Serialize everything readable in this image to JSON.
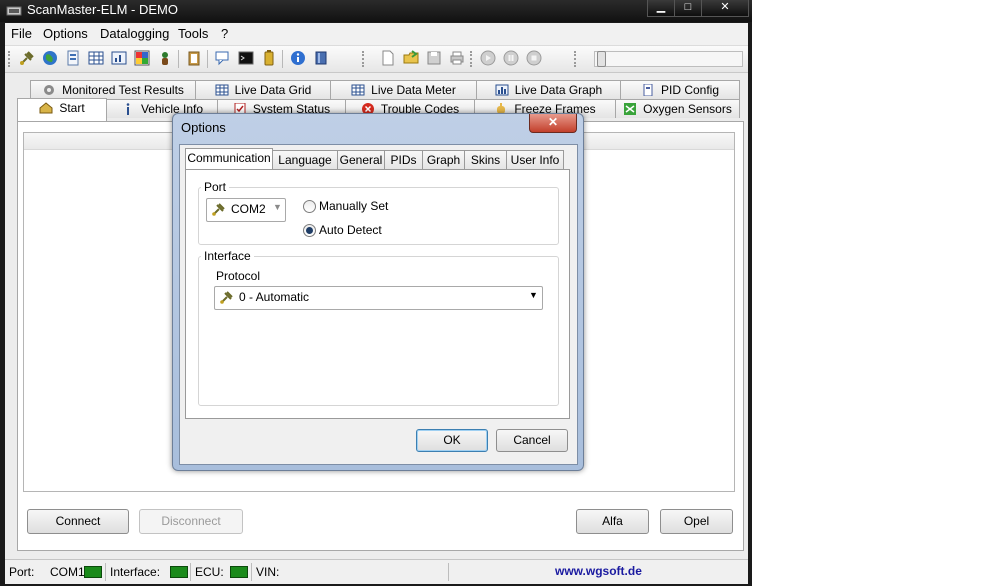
{
  "window": {
    "title": "ScanMaster-ELM - DEMO",
    "controls": {
      "minimize": "▁",
      "maximize": "□",
      "close": "✕"
    }
  },
  "menu": [
    "File",
    "Options",
    "Datalogging",
    "Tools",
    "?"
  ],
  "tabs": {
    "row1": [
      "Monitored Test Results",
      "Live Data Grid",
      "Live Data Meter",
      "Live Data Graph",
      "PID Config"
    ],
    "row2": [
      "Start",
      "Vehicle Info",
      "System Status",
      "Trouble Codes",
      "Freeze Frames",
      "Oxygen Sensors"
    ]
  },
  "buttons": {
    "connect": "Connect",
    "disconnect": "Disconnect",
    "alfa": "Alfa",
    "opel": "Opel"
  },
  "status": {
    "port_label": "Port:",
    "port_value": "COM1",
    "interface_label": "Interface:",
    "ecu_label": "ECU:",
    "vin_label": "VIN:",
    "website": "www.wgsoft.de",
    "led_color": "#1a8a1a"
  },
  "dialog": {
    "title": "Options",
    "close": "✕",
    "tabs": [
      "Communication",
      "Language",
      "General",
      "PIDs",
      "Graph",
      "Skins",
      "User Info"
    ],
    "port": {
      "group_label": "Port",
      "selected": "COM2",
      "radio_manual": "Manually Set",
      "radio_auto": "Auto Detect",
      "selected_radio": "auto"
    },
    "interface": {
      "group_label": "Interface",
      "protocol_label": "Protocol",
      "protocol_value": "0 - Automatic"
    },
    "ok": "OK",
    "cancel": "Cancel"
  }
}
